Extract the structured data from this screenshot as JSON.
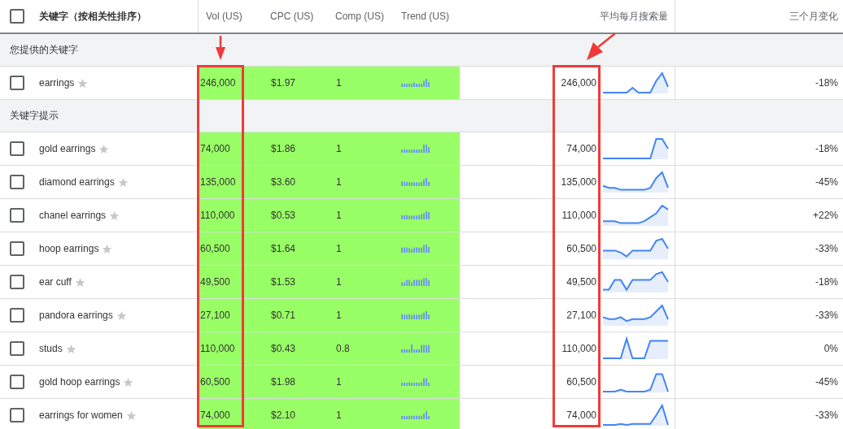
{
  "table": {
    "select_all": {
      "checked": false
    },
    "columns": [
      {
        "label": "关键字（按相关性排序）",
        "highlighted": false
      },
      {
        "label": "Vol (US)",
        "highlighted": true
      },
      {
        "label": "CPC (US)",
        "highlighted": false
      },
      {
        "label": "Comp (US)",
        "highlighted": false
      },
      {
        "label": "Trend (US)",
        "highlighted": false
      },
      {
        "label": "平均每月搜索量",
        "highlighted": true
      },
      {
        "label": "三个月变化",
        "highlighted": false
      }
    ],
    "groups": [
      {
        "label": "您提供的关键字",
        "rows": [
          {
            "keyword": "earrings",
            "checked": false,
            "starred": false,
            "vol": "246,000",
            "cpc": "$1.97",
            "comp": "1",
            "avg": "246,000",
            "change": "-18%"
          }
        ]
      },
      {
        "label": "关键字提示",
        "rows": [
          {
            "keyword": "gold earrings",
            "checked": false,
            "starred": false,
            "vol": "74,000",
            "cpc": "$1.86",
            "comp": "1",
            "avg": "74,000",
            "change": "-18%"
          },
          {
            "keyword": "diamond earrings",
            "checked": false,
            "starred": false,
            "vol": "135,000",
            "cpc": "$3.60",
            "comp": "1",
            "avg": "135,000",
            "change": "-45%"
          },
          {
            "keyword": "chanel earrings",
            "checked": false,
            "starred": false,
            "vol": "110,000",
            "cpc": "$0.53",
            "comp": "1",
            "avg": "110,000",
            "change": "+22%"
          },
          {
            "keyword": "hoop earrings",
            "checked": false,
            "starred": false,
            "vol": "60,500",
            "cpc": "$1.64",
            "comp": "1",
            "avg": "60,500",
            "change": "-33%"
          },
          {
            "keyword": "ear cuff",
            "checked": false,
            "starred": false,
            "vol": "49,500",
            "cpc": "$1.53",
            "comp": "1",
            "avg": "49,500",
            "change": "-18%"
          },
          {
            "keyword": "pandora earrings",
            "checked": false,
            "starred": false,
            "vol": "27,100",
            "cpc": "$0.71",
            "comp": "1",
            "avg": "27,100",
            "change": "-33%"
          },
          {
            "keyword": "studs",
            "checked": false,
            "starred": false,
            "vol": "110,000",
            "cpc": "$0.43",
            "comp": "0.8",
            "avg": "110,000",
            "change": "0%"
          },
          {
            "keyword": "gold hoop earrings",
            "checked": false,
            "starred": false,
            "vol": "60,500",
            "cpc": "$1.98",
            "comp": "1",
            "avg": "60,500",
            "change": "-45%"
          },
          {
            "keyword": "earrings for women",
            "checked": false,
            "starred": false,
            "vol": "74,000",
            "cpc": "$2.10",
            "comp": "1",
            "avg": "74,000",
            "change": "-33%"
          }
        ]
      }
    ]
  }
}
